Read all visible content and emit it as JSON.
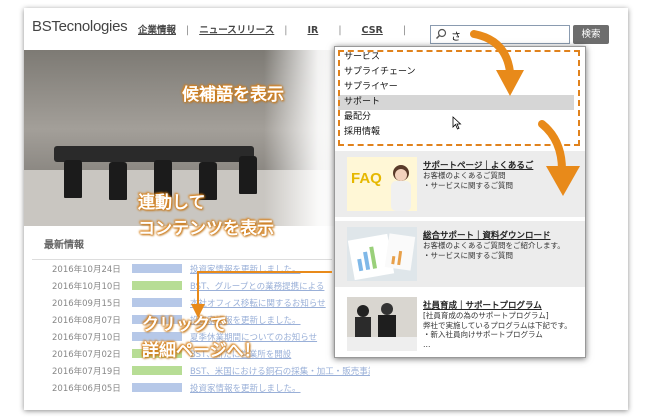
{
  "header": {
    "logo": "BSTecnologies",
    "nav": [
      "企業情報",
      "ニュースリリース",
      "IR",
      "CSR"
    ],
    "search_value": "さ",
    "search_button": "検索"
  },
  "suggestions": [
    "サービス",
    "サプライチェーン",
    "サプライヤー",
    "サポート",
    "最配分",
    "採用情報"
  ],
  "highlighted_index": 3,
  "cards": [
    {
      "title": "サポートページ｜よくあるご",
      "desc": [
        "お客様のよくあるご質問",
        "・サービスに関するご質問"
      ],
      "thumb_label": "FAQ"
    },
    {
      "title": "総合サポート｜資料ダウンロード",
      "desc": [
        "お客様のよくあるご質問をご紹介します。",
        "・サービスに関するご質問"
      ]
    },
    {
      "title": "社員育成｜サポートプログラム",
      "desc": [
        "[社員育成の為のサポートプログラム]",
        "弊社で実施しているプログラムは下記です。",
        "・新入社員向けサポートプログラム",
        "…"
      ]
    }
  ],
  "news": {
    "title": "最新情報",
    "rows": [
      {
        "date": "2016年10月24日",
        "tag_color": "blue",
        "text": "投資家情報を更新しました。"
      },
      {
        "date": "2016年10月10日",
        "tag_color": "green",
        "text": "BST、グループとの業務提携による"
      },
      {
        "date": "2016年09月15日",
        "tag_color": "blue",
        "text": "本社オフィス移転に関するお知らせ"
      },
      {
        "date": "2016年08月07日",
        "tag_color": "blue",
        "text": "投資家情報を更新しました。"
      },
      {
        "date": "2016年07月10日",
        "tag_color": "blue",
        "text": "夏季休業期間についてのお知らせ"
      },
      {
        "date": "2016年07月02日",
        "tag_color": "green",
        "text": "BST、新たに営業所を開設"
      },
      {
        "date": "2016年07月19日",
        "tag_color": "green",
        "text": "BST、米国における銅石の採集・加工・販売事業に参画"
      },
      {
        "date": "2016年06月05日",
        "tag_color": "blue",
        "text": "投資家情報を更新しました。"
      }
    ]
  },
  "callouts": {
    "suggest": "候補語を表示",
    "linked_line1": "連動して",
    "linked_line2": "コンテンツを表示",
    "click_line1": "クリックで",
    "click_line2": "詳細ページへ！"
  },
  "colors": {
    "accent": "#e0821d",
    "highlight": "#d6d6d6",
    "search_button": "#6d6d6d"
  }
}
